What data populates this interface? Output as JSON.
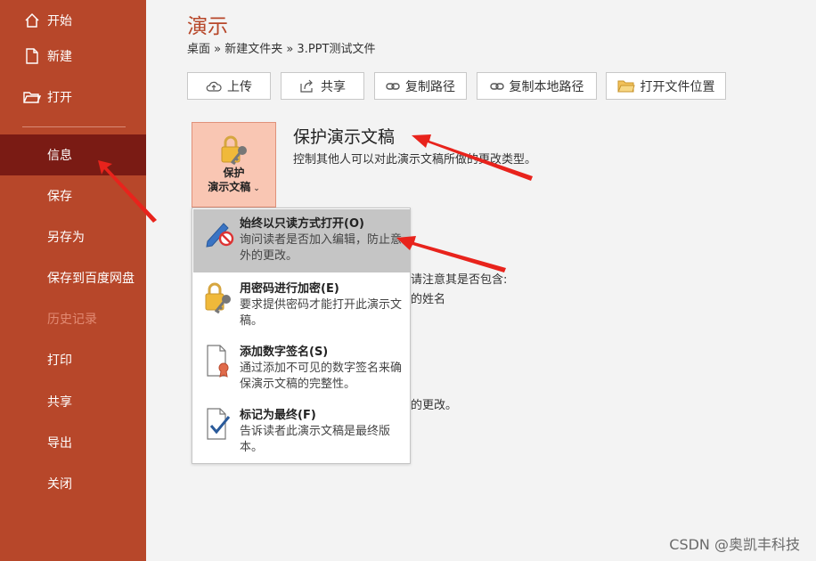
{
  "sidebar": {
    "items": [
      {
        "label": "开始",
        "icon": "home-icon"
      },
      {
        "label": "新建",
        "icon": "new-doc-icon"
      },
      {
        "label": "打开",
        "icon": "open-folder-icon"
      },
      {
        "label": "信息"
      },
      {
        "label": "保存"
      },
      {
        "label": "另存为"
      },
      {
        "label": "保存到百度网盘"
      },
      {
        "label": "历史记录"
      },
      {
        "label": "打印"
      },
      {
        "label": "共享"
      },
      {
        "label": "导出"
      },
      {
        "label": "关闭"
      }
    ],
    "active_item": "信息",
    "disabled_item": "历史记录"
  },
  "main": {
    "title": "演示",
    "breadcrumb": "桌面 » 新建文件夹 » 3.PPT测试文件",
    "buttons": [
      {
        "label": "上传",
        "icon": "upload-cloud-icon"
      },
      {
        "label": "共享",
        "icon": "share-icon"
      },
      {
        "label": "复制路径",
        "icon": "link-icon"
      },
      {
        "label": "复制本地路径",
        "icon": "link-icon"
      },
      {
        "label": "打开文件位置",
        "icon": "folder-icon"
      }
    ],
    "protect": {
      "tile_line1": "保护",
      "tile_line2": "演示文稿",
      "title": "保护演示文稿",
      "description": "控制其他人可以对此演示文稿所做的更改类型。"
    },
    "background_fragments": [
      "请注意其是否包含:",
      "的姓名",
      "的更改。"
    ]
  },
  "protect_menu": {
    "items": [
      {
        "title": "始终以只读方式打开(O)",
        "description": "询问读者是否加入编辑，防止意外的更改。",
        "icon": "pencil-no-icon",
        "highlighted": true
      },
      {
        "title": "用密码进行加密(E)",
        "description": "要求提供密码才能打开此演示文稿。",
        "icon": "lock-key-icon",
        "highlighted": false
      },
      {
        "title": "添加数字签名(S)",
        "description": "通过添加不可见的数字签名来确保演示文稿的完整性。",
        "icon": "signature-icon",
        "highlighted": false
      },
      {
        "title": "标记为最终(F)",
        "description": "告诉读者此演示文稿是最终版本。",
        "icon": "mark-final-icon",
        "highlighted": false
      }
    ]
  },
  "watermark": "CSDN @奥凯丰科技",
  "colors": {
    "accent": "#b7472a",
    "active": "#7a1b14",
    "annotation_arrow": "#e8231c",
    "menu_highlight": "#c5c5c5"
  }
}
